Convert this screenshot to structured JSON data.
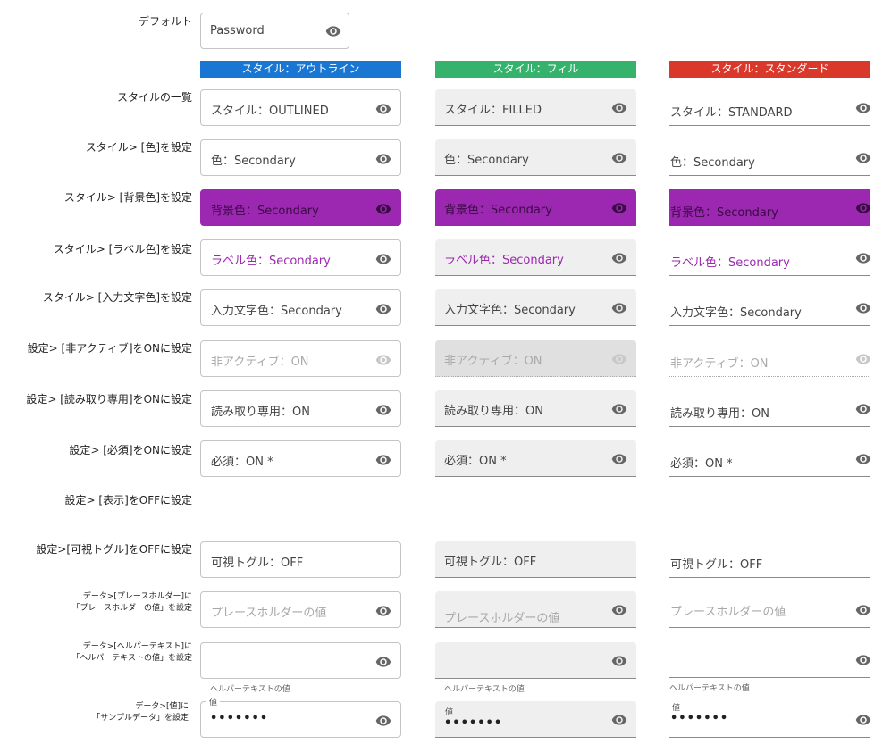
{
  "default": {
    "label": "デフォルト",
    "field_text": "Password"
  },
  "headers": {
    "outlined": "スタイル：アウトライン",
    "filled": "スタイル：フィル",
    "standard": "スタイル：スタンダード"
  },
  "colors": {
    "outlined_header": "#1976d2",
    "filled_header": "#35b36c",
    "standard_header": "#d9382b",
    "secondary": "#9c27b0"
  },
  "rows": {
    "style_list": {
      "label": "スタイルの一覧",
      "outlined": "スタイル：OUTLINED",
      "filled": "スタイル：FILLED",
      "standard": "スタイル：STANDARD"
    },
    "color": {
      "label": "スタイル> [色]を設定",
      "value": "色：Secondary"
    },
    "bgcolor": {
      "label": "スタイル> [背景色]を設定",
      "value": "背景色：Secondary"
    },
    "labelcolor": {
      "label": "スタイル> [ラベル色]を設定",
      "value": "ラベル色：Secondary"
    },
    "inputcolor": {
      "label": "スタイル> [入力文字色]を設定",
      "value": "入力文字色：Secondary"
    },
    "inactive": {
      "label": "設定> [非アクティブ]をONに設定",
      "value": "非アクティブ：ON"
    },
    "readonly": {
      "label": "設定> [読み取り専用]をONに設定",
      "value": "読み取り専用：ON"
    },
    "required": {
      "label": "設定> [必須]をONに設定",
      "value": "必須：ON *"
    },
    "display": {
      "label": "設定> [表示]をOFFに設定"
    },
    "toggle": {
      "label": "設定>[可視トグル]をOFFに設定",
      "value": "可視トグル：OFF"
    },
    "placeholder": {
      "label_line1": "データ>[プレースホルダー]に",
      "label_line2": "「プレースホルダーの値」を設定",
      "value": "プレースホルダーの値"
    },
    "helper": {
      "label_line1": "データ>[ヘルパーテキスト]に",
      "label_line2": "「ヘルパーテキストの値」を設定",
      "helper_text": "ヘルパーテキストの値"
    },
    "value": {
      "label_line1": "データ>[値]に",
      "label_line2": "「サンプルデータ」を設定",
      "field_label": "値",
      "masked": "•••••••"
    }
  }
}
